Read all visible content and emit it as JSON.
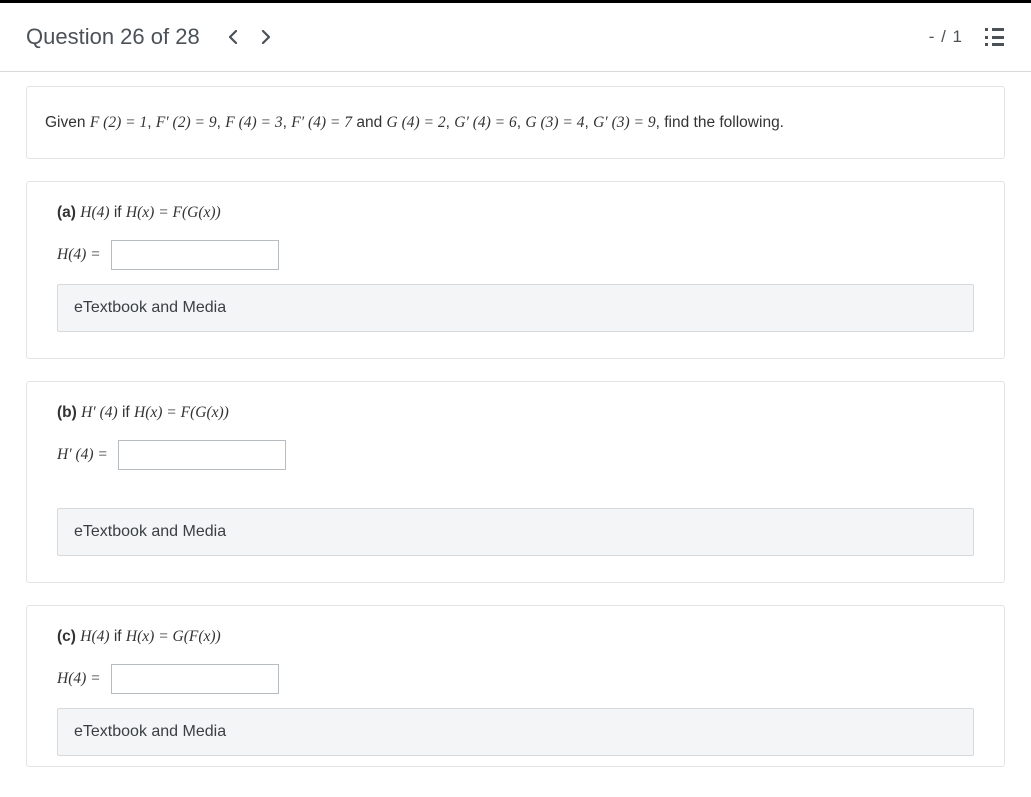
{
  "header": {
    "title": "Question 26 of 28",
    "score": "- / 1"
  },
  "given": {
    "prefix": "Given ",
    "F2": "F (2) = 1",
    "Fp2": "F′ (2) = 9",
    "F4": "F (4) = 3",
    "Fp4": "F′ (4) = 7",
    "mid": " and ",
    "G4": "G (4) = 2",
    "Gp4": "G′ (4) = 6",
    "G3": "G (3) = 4",
    "Gp3": "G′ (3) = 9",
    "suffix": ", find the following."
  },
  "parts": {
    "a": {
      "label": "(a)",
      "desc_lhs": "H(4)",
      "desc_mid": " if ",
      "desc_rhs": "H(x) = F(G(x))",
      "answer_lhs": "H(4) ="
    },
    "b": {
      "label": "(b)",
      "desc_lhs": "H′ (4)",
      "desc_mid": " if ",
      "desc_rhs": "H(x) = F(G(x))",
      "answer_lhs": "H′ (4) ="
    },
    "c": {
      "label": "(c)",
      "desc_lhs": "H(4)",
      "desc_mid": " if ",
      "desc_rhs": "H(x) = G(F(x))",
      "answer_lhs": "H(4) ="
    }
  },
  "buttons": {
    "etextbook": "eTextbook and Media"
  }
}
